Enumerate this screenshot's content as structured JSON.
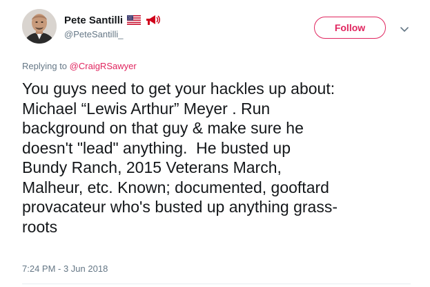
{
  "user": {
    "name": "Pete Santilli",
    "handle": "@PeteSantilli_",
    "avatar_icon": "avatar-photo",
    "badges": [
      "us-flag-icon",
      "megaphone-icon"
    ]
  },
  "follow_button": {
    "label": "Follow",
    "color": "#e0245e"
  },
  "menu_icon": "chevron-down-icon",
  "reply": {
    "prefix": "Replying to",
    "mention": "@CraigRSawyer"
  },
  "tweet": {
    "text": "You guys need to get your hackles up about:\nMichael “Lewis Arthur” Meyer . Run\nbackground on that guy & make sure he\ndoesn't \"lead\" anything.  He busted up\nBundy Ranch, 2015 Veterans March,\nMalheur, etc. Known; documented, gooftard\nprovacateur who's busted up anything grass-\nroots"
  },
  "timestamp": "7:24 PM - 3 Jun 2018",
  "colors": {
    "text": "#14171a",
    "muted": "#657786",
    "accent": "#e0245e",
    "divider": "#e6ecf0"
  }
}
